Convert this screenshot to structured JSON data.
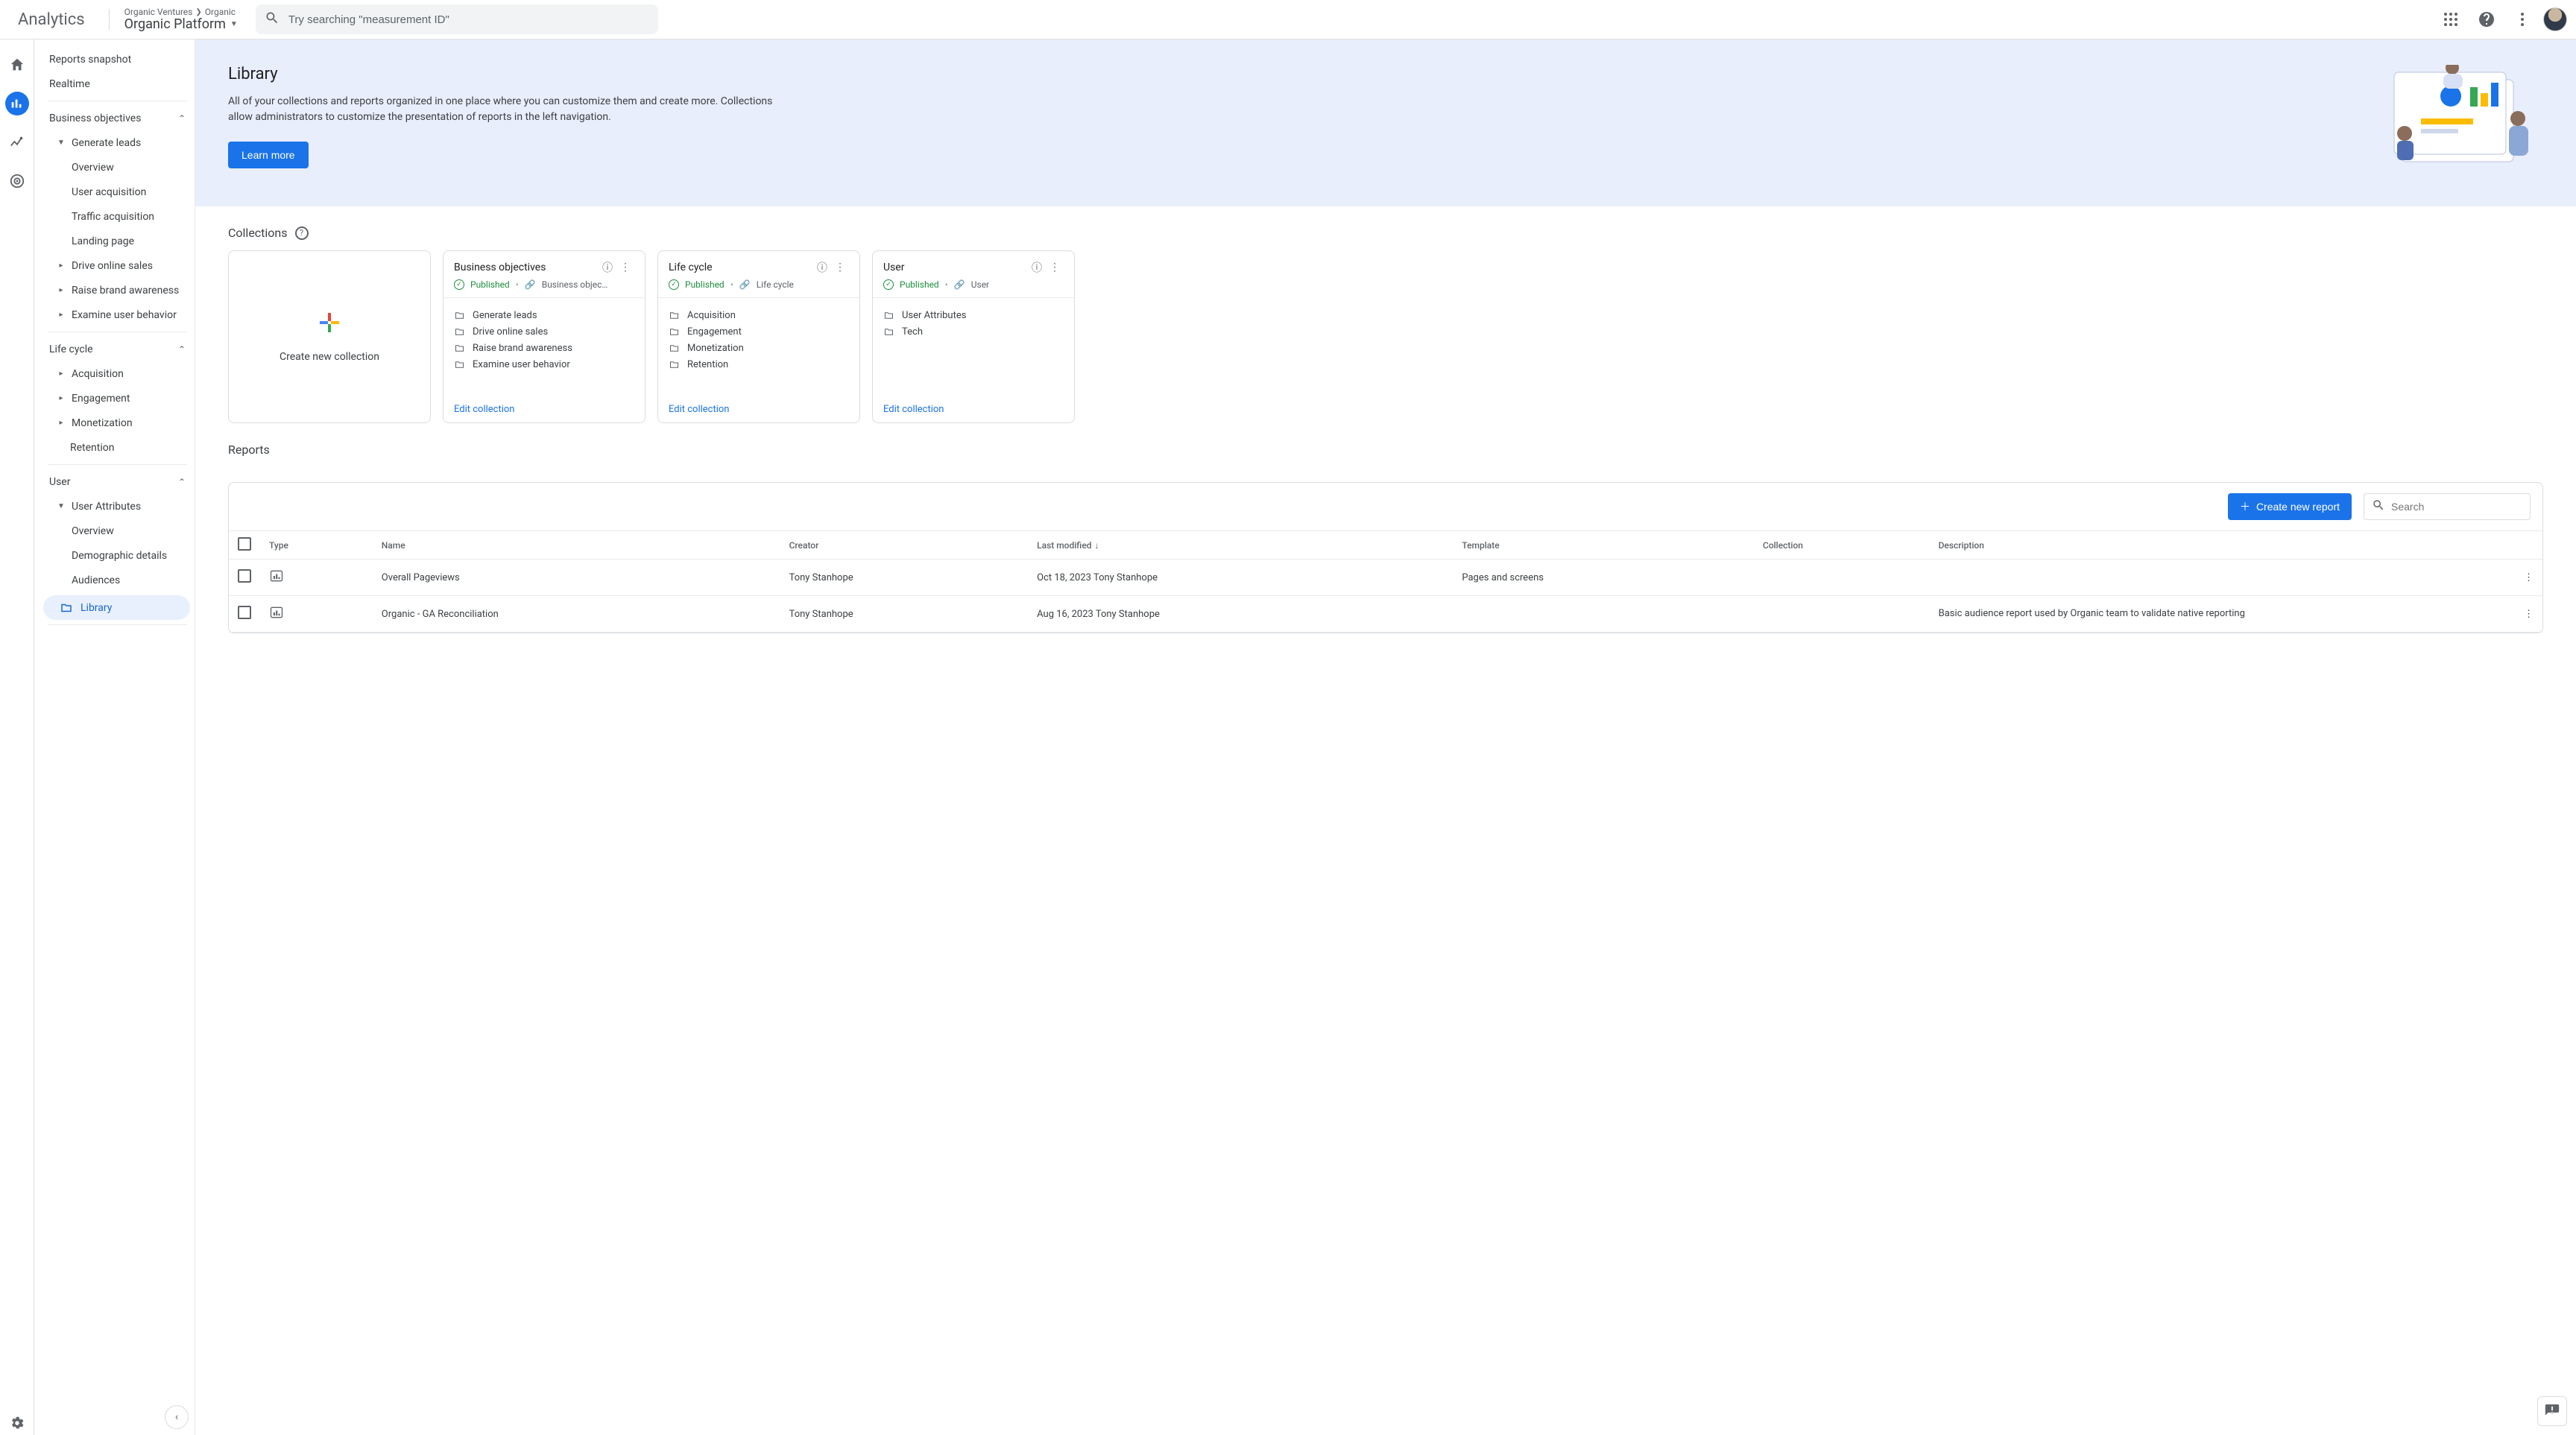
{
  "header": {
    "product": "Analytics",
    "breadcrumb": {
      "org": "Organic Ventures",
      "prop": "Organic"
    },
    "property": "Organic Platform",
    "search_placeholder": "Try searching \"measurement ID\""
  },
  "sidebar": {
    "top": {
      "snapshot": "Reports snapshot",
      "realtime": "Realtime"
    },
    "biz": {
      "head": "Business objectives",
      "gen_leads": "Generate leads",
      "leaf_overview": "Overview",
      "leaf_user_acq": "User acquisition",
      "leaf_traffic_acq": "Traffic acquisition",
      "leaf_landing": "Landing page",
      "drive": "Drive online sales",
      "raise": "Raise brand awareness",
      "examine": "Examine user behavior"
    },
    "life": {
      "head": "Life cycle",
      "acq": "Acquisition",
      "eng": "Engagement",
      "mon": "Monetization",
      "ret": "Retention"
    },
    "user": {
      "head": "User",
      "attrs": "User Attributes",
      "leaf_overview": "Overview",
      "leaf_demo": "Demographic details",
      "leaf_aud": "Audiences"
    },
    "library": "Library"
  },
  "hero": {
    "title": "Library",
    "desc": "All of your collections and reports organized in one place where you can customize them and create more. Collections allow administrators to customize the presentation of reports in the left navigation.",
    "learn": "Learn more"
  },
  "collections": {
    "head": "Collections",
    "create": "Create new collection",
    "edit": "Edit collection",
    "published": "Published",
    "cards": [
      {
        "title": "Business objectives",
        "link": "Business object…",
        "items": [
          "Generate leads",
          "Drive online sales",
          "Raise brand awareness",
          "Examine user behavior"
        ]
      },
      {
        "title": "Life cycle",
        "link": "Life cycle",
        "items": [
          "Acquisition",
          "Engagement",
          "Monetization",
          "Retention"
        ]
      },
      {
        "title": "User",
        "link": "User",
        "items": [
          "User Attributes",
          "Tech"
        ]
      }
    ]
  },
  "reports": {
    "head": "Reports",
    "create": "Create new report",
    "search_placeholder": "Search",
    "cols": {
      "type": "Type",
      "name": "Name",
      "creator": "Creator",
      "last": "Last modified",
      "template": "Template",
      "collection": "Collection",
      "description": "Description"
    },
    "rows": [
      {
        "name": "Overall Pageviews",
        "creator": "Tony Stanhope",
        "last": "Oct 18, 2023 Tony Stanhope",
        "template": "Pages and screens",
        "collection": "",
        "description": ""
      },
      {
        "name": "Organic - GA Reconciliation",
        "creator": "Tony Stanhope",
        "last": "Aug 16, 2023 Tony Stanhope",
        "template": "",
        "collection": "",
        "description": "Basic audience report used by Organic team to validate native reporting"
      }
    ]
  }
}
